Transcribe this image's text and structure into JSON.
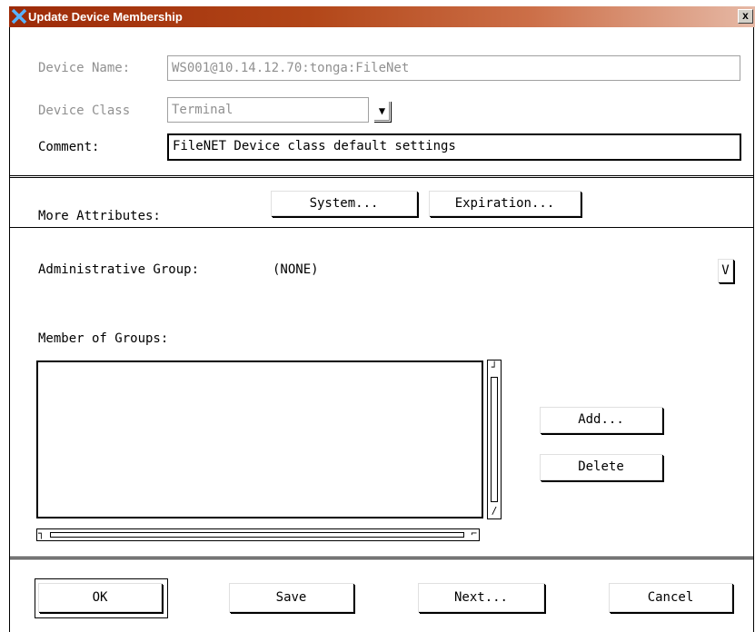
{
  "window": {
    "title": "Update Device Membership",
    "close_glyph": "x",
    "title_icon": "x-logo-icon"
  },
  "identity": {
    "device_name_label": "Device Name:",
    "device_name_value": "WS001@10.14.12.70:tonga:FileNet",
    "device_class_label": "Device Class",
    "device_class_value": "Terminal",
    "device_class_dropdown_glyph": "▼",
    "comment_label": "Comment:",
    "comment_value": "FileNET Device class default settings"
  },
  "attributes": {
    "label": "More Attributes:",
    "system_button": "System...",
    "expiration_button": "Expiration..."
  },
  "groups": {
    "admin_group_label": "Administrative Group:",
    "admin_group_value": "(NONE)",
    "admin_group_dropdown_glyph": "V",
    "member_label": "Member of Groups:",
    "members": [],
    "add_button": "Add...",
    "delete_button": "Delete"
  },
  "footer": {
    "ok_button": "OK",
    "save_button": "Save",
    "next_button": "Next...",
    "cancel_button": "Cancel"
  },
  "colors": {
    "titlebar_start": "#9c2a08",
    "titlebar_end": "#e6b9a6",
    "disabled_text": "#909090"
  }
}
